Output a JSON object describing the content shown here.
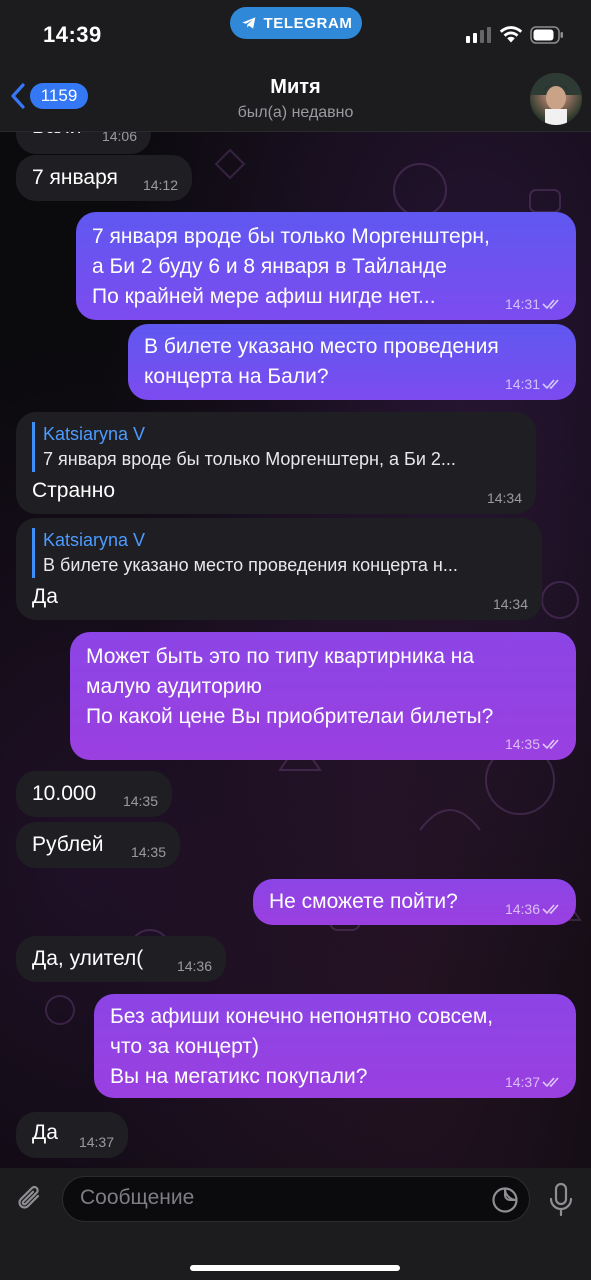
{
  "status_bar": {
    "time": "14:39",
    "app_pill": "TELEGRAM"
  },
  "header": {
    "back_count": "1159",
    "title": "Митя",
    "subtitle": "был(а) недавно"
  },
  "messages": [
    {
      "dir": "in",
      "text": "Бали",
      "time": "14:06"
    },
    {
      "dir": "in",
      "text": "7 января",
      "time": "14:12"
    },
    {
      "dir": "out",
      "lines": [
        "7 января вроде бы только Моргенштерн,",
        "а Би 2 буду 6 и 8 января  в Тайланде",
        "По крайней мере афиш нигде нет..."
      ],
      "time": "14:31"
    },
    {
      "dir": "out",
      "lines": [
        "В билете указано место проведения",
        "концерта на Бали?"
      ],
      "time": "14:31"
    },
    {
      "dir": "in",
      "reply_author": "Katsiaryna V",
      "reply_text": "7 января вроде бы только Моргенштерн, а Би 2...",
      "text": "Странно",
      "time": "14:34"
    },
    {
      "dir": "in",
      "reply_author": "Katsiaryna V",
      "reply_text": "В билете указано место проведения концерта н...",
      "text": "Да",
      "time": "14:34"
    },
    {
      "dir": "out",
      "lines": [
        "Может быть это по типу квартирника на",
        "малую аудиторию",
        "По какой цене Вы приобрителаи билеты?"
      ],
      "time": "14:35"
    },
    {
      "dir": "in",
      "text": "10.000",
      "time": "14:35"
    },
    {
      "dir": "in",
      "text": "Рублей",
      "time": "14:35"
    },
    {
      "dir": "out",
      "text": "Не сможете пойти?",
      "time": "14:36"
    },
    {
      "dir": "in",
      "text": "Да, улител(",
      "time": "14:36"
    },
    {
      "dir": "out",
      "lines": [
        "Без афиши конечно непонятно совсем,",
        "что за концерт)",
        "Вы на мегатикс покупали?"
      ],
      "time": "14:37"
    },
    {
      "dir": "in",
      "text": "Да",
      "time": "14:37"
    }
  ],
  "input": {
    "placeholder": "Сообщение"
  },
  "icons": {
    "back": "chevron-left-icon",
    "attach": "paperclip-icon",
    "sticker": "sticker-icon",
    "mic": "microphone-icon",
    "read_receipt": "double-check-icon"
  },
  "colors": {
    "accent": "#3478f6",
    "outgoing_bubble": "#6a52f0",
    "incoming_bubble": "#1f1e23",
    "reply_author": "#4c9bff"
  }
}
